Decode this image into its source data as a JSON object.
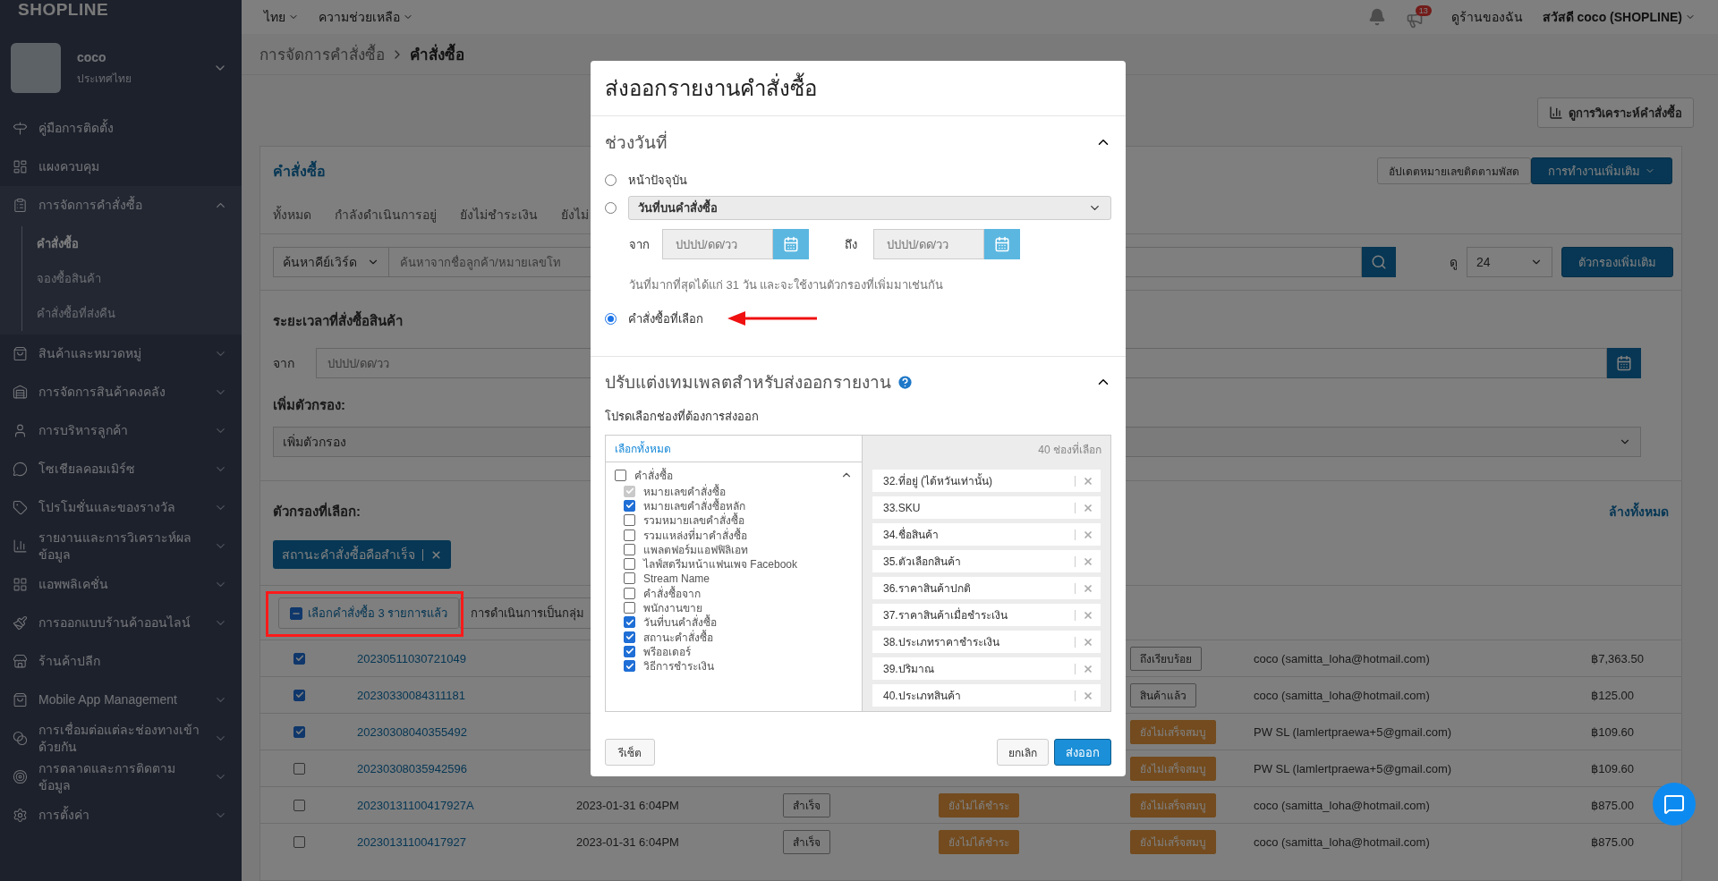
{
  "sidebar": {
    "logo": "SHOPLINE",
    "store": {
      "name": "coco",
      "country": "ประเทศไทย",
      "expanded": false
    },
    "items": [
      {
        "label": "คู่มือการติดตั้ง"
      },
      {
        "label": "แผงควบคุม"
      },
      {
        "label": "การจัดการคำสั่งซื้อ",
        "expanded": true,
        "children": [
          {
            "label": "คำสั่งซื้อ",
            "selected": true
          },
          {
            "label": "จองซื้อสินค้า",
            "selected": false
          },
          {
            "label": "คำสั่งซื้อที่ส่งคืน",
            "selected": false
          }
        ]
      },
      {
        "label": "สินค้าและหมวดหมู่",
        "expanded": false
      },
      {
        "label": "การจัดการสินค้าคงคลัง",
        "expanded": false
      },
      {
        "label": "การบริหารลูกค้า",
        "expanded": false
      },
      {
        "label": "โซเชียลคอมเมิร์ซ",
        "expanded": false
      },
      {
        "label": "โปรโมชั่นและของรางวัล",
        "expanded": false
      },
      {
        "label": "รายงานและการวิเคราะห์ผลข้อมูล",
        "expanded": false
      },
      {
        "label": "แอพพลิเคชั่น",
        "expanded": false
      },
      {
        "label": "การออกแบบร้านค้าออนไลน์",
        "expanded": false
      },
      {
        "label": "ร้านค้าปลีก"
      },
      {
        "label": "Mobile App Management",
        "expanded": false
      },
      {
        "label": "การเชื่อมต่อแต่ละช่องทางเข้าด้วยกัน",
        "expanded": false
      },
      {
        "label": "การตลาดและการติดตามข้อมูล",
        "expanded": false
      },
      {
        "label": "การตั้งค่า",
        "expanded": false
      }
    ]
  },
  "topbar": {
    "menus": [
      "ไทย",
      "ความช่วยเหลือ"
    ],
    "notification_count": "13",
    "view_store": "ดูร้านของฉัน",
    "greeting": "สวัสดี coco (SHOPLINE)"
  },
  "breadcrumb": [
    {
      "label": "การจัดการคำสั่งซื้อ",
      "current": false
    },
    {
      "label": "คำสั่งซื้อ",
      "current": true
    }
  ],
  "analytics_button": "ดูการวิเคราะห์คำสั่งซื้อ",
  "orders_card": {
    "title": "คำสั่งซื้อ",
    "update_tracking_button": "อัปเดตหมายเลขติดตามพัสด",
    "more_actions_button": "การทำงานเพิ่มเติม",
    "tabs": [
      "ทั้งหมด",
      "กำลังดำเนินการอยู่",
      "ยังไม่ชำระเงิน",
      "ยังไม่"
    ],
    "search": {
      "keyword_select": "ค้นหาคีย์เวิร์ด",
      "placeholder": "ค้นหาจากชื่อลูกค้า/หมายเลขโท",
      "per_page_label": "ดู",
      "per_page": "24",
      "more_filters_button": "ตัวกรองเพิ่มเติม"
    },
    "filters": {
      "period_title": "ระยะเวลาที่สั่งซื้อสินค้า",
      "from_label": "จาก",
      "from_placeholder": "ปปปป/ดด/วว",
      "add_filter_title": "เพิ่มตัวกรอง:",
      "add_filter_select": "เพิ่มตัวกรอง",
      "selected_title": "ตัวกรองที่เลือก:",
      "clear_all": "ล้างทั้งหมด",
      "chips": [
        "สถานะคำสั่งซื้อคือสำเร็จ"
      ]
    },
    "bulk": {
      "selected_button": "เลือกคำสั่งซื้อ 3 รายการแล้ว",
      "highlighted": true,
      "actions_button": "การดำเนินการเป็นกลุ่ม"
    },
    "orders": [
      {
        "checked": true,
        "order_no": "20230511030721049",
        "delivery": {
          "text": "ถึงเรียบร้อย",
          "kind": "outline"
        },
        "customer": "coco (samitta_loha@hotmail.com)",
        "total": "฿7,363.50"
      },
      {
        "checked": true,
        "order_no": "20230330084311181",
        "delivery": {
          "text": "สินค้าแล้ว",
          "kind": "outline"
        },
        "customer": "coco (samitta_loha@hotmail.com)",
        "total": "฿125.00"
      },
      {
        "checked": true,
        "order_no": "20230308040355492",
        "delivery": {
          "text": "ยังไม่เสร็จสมบู",
          "kind": "warning"
        },
        "customer": "PW SL (lamlertpraewa+5@gmail.com)",
        "total": "฿109.60"
      },
      {
        "checked": false,
        "order_no": "20230308035942596",
        "delivery": {
          "text": "ยังไม่เสร็จสมบู",
          "kind": "warning"
        },
        "customer": "PW SL (lamlertpraewa+5@gmail.com)",
        "total": "฿109.60"
      },
      {
        "checked": false,
        "order_no": "20230131100417927A",
        "date": "2023-01-31 6:04PM",
        "status": {
          "text": "สำเร็จ",
          "kind": "outline"
        },
        "payment": {
          "text": "ยังไม่ได้ชำระ",
          "kind": "warning"
        },
        "delivery": {
          "text": "ยังไม่เสร็จสมบู",
          "kind": "warning"
        },
        "customer": "coco (samitta_loha@hotmail.com)",
        "total": "฿875.00"
      },
      {
        "checked": false,
        "order_no": "20230131100417927",
        "date": "2023-01-31 6:04PM",
        "status": {
          "text": "สำเร็จ",
          "kind": "outline"
        },
        "payment": {
          "text": "ยังไม่ได้ชำระ",
          "kind": "warning"
        },
        "delivery": {
          "text": "ยังไม่เสร็จสมบู",
          "kind": "warning"
        },
        "customer": "coco (samitta_loha@hotmail.com)",
        "total": "฿875.00"
      }
    ]
  },
  "export_dialog": {
    "title": "ส่งออกรายงานคำสั่งซื้อ",
    "date_section": {
      "title": "ช่วงวันที่",
      "expanded": true,
      "options": [
        {
          "kind": "label",
          "label": "หน้าปัจจุบัน",
          "selected": false
        },
        {
          "kind": "select",
          "value": "วันที่บนคำสั่งซื้อ",
          "selected": false
        },
        {
          "kind": "label",
          "label": "คำสั่งซื้อที่เลือก",
          "selected": true,
          "highlighted": true
        }
      ],
      "from_label": "จาก",
      "from_placeholder": "ปปปป/ดด/วว",
      "to_label": "ถึง",
      "to_placeholder": "ปปปป/ดด/วว",
      "note": "วันที่มากที่สุดได้แก่ 31 วัน และจะใช้งานตัวกรองที่เพิ่มมาเช่นกัน"
    },
    "template_section": {
      "title": "ปรับแต่งเทมเพลตสำหรับส่งออกรายงาน",
      "expanded": true,
      "instruction": "โปรดเลือกช่องที่ต้องการส่งออก",
      "select_all": "เลือกทั้งหมด",
      "selected_count": "40 ช่องที่เลือก",
      "groups": [
        {
          "label": "คำสั่งซื้อ",
          "checked": false,
          "expanded": true,
          "children": [
            {
              "label": "หมายเลขคำสั่งซื้อ",
              "checked": true,
              "disabled": true
            },
            {
              "label": "หมายเลขคำสั่งซื้อหลัก",
              "checked": true
            },
            {
              "label": "รวมหมายเลขคำสั่งซื้อ",
              "checked": false
            },
            {
              "label": "รวมแหล่งที่มาคำสั่งซื้อ",
              "checked": false
            },
            {
              "label": "แพลตฟอร์มแอฟฟิลิเอท",
              "checked": false
            },
            {
              "label": "ไลฟ์สดรีมหน้าแฟนเพจ Facebook",
              "checked": false
            },
            {
              "label": "Stream Name",
              "checked": false
            },
            {
              "label": "คำสั่งซื้อจาก",
              "checked": false
            },
            {
              "label": "พนักงานขาย",
              "checked": false
            },
            {
              "label": "วันที่บนคำสั่งซื้อ",
              "checked": true
            },
            {
              "label": "สถานะคำสั่งซื้อ",
              "checked": true
            },
            {
              "label": "พรีออเดอร์",
              "checked": true
            },
            {
              "label": "วิธีการชำระเงิน",
              "checked": true
            }
          ]
        }
      ],
      "selected_fields": [
        "32.ที่อยู่ (ได้หวันเท่านั้น)",
        "33.SKU",
        "34.ชื่อสินค้า",
        "35.ตัวเลือกสินค้า",
        "36.ราคาสินค้าปกติ",
        "37.ราคาสินค้าเมื่อชำระเงิน",
        "38.ประเภทราคาชำระเงิน",
        "39.ปริมาณ",
        "40.ประเภทสินค้า"
      ]
    },
    "buttons": {
      "reset": "รีเซ็ต",
      "cancel": "ยกเลิก",
      "export": "ส่งออก"
    }
  }
}
